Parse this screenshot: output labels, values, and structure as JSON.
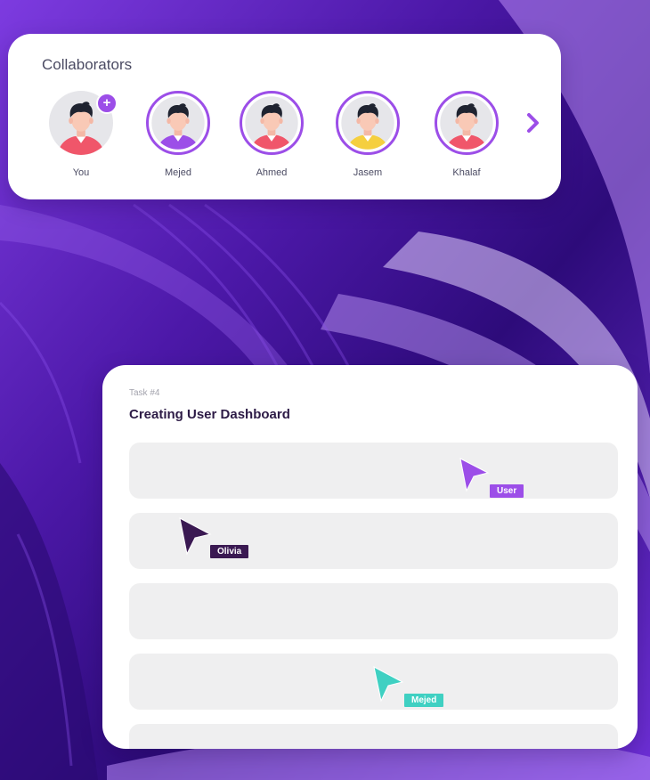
{
  "colors": {
    "accent": "#9c4ee8",
    "card_bg": "#ffffff",
    "row_bg": "#efeff0",
    "title_dark": "#2d1b46",
    "cursor_user": "#9c4ee8",
    "cursor_olivia": "#3a1952",
    "cursor_mejed": "#3fd0c2"
  },
  "collaborators": {
    "title": "Collaborators",
    "next_icon": "chevron-right-icon",
    "people": [
      {
        "name": "You",
        "shirt": "#f0566a",
        "ring": false,
        "add_badge": "+"
      },
      {
        "name": "Mejed",
        "shirt": "#9c4ee8",
        "ring": true
      },
      {
        "name": "Ahmed",
        "shirt": "#f0566a",
        "ring": true
      },
      {
        "name": "Jasem",
        "shirt": "#f5cf3f",
        "ring": true
      },
      {
        "name": "Khalaf",
        "shirt": "#f0566a",
        "ring": true
      }
    ]
  },
  "task": {
    "label": "Task #4",
    "title": "Creating User Dashboard",
    "row_count": 5,
    "cursors": [
      {
        "label": "User",
        "color": "#9c4ee8"
      },
      {
        "label": "Olivia",
        "color": "#3a1952"
      },
      {
        "label": "Mejed",
        "color": "#3fd0c2"
      }
    ]
  }
}
